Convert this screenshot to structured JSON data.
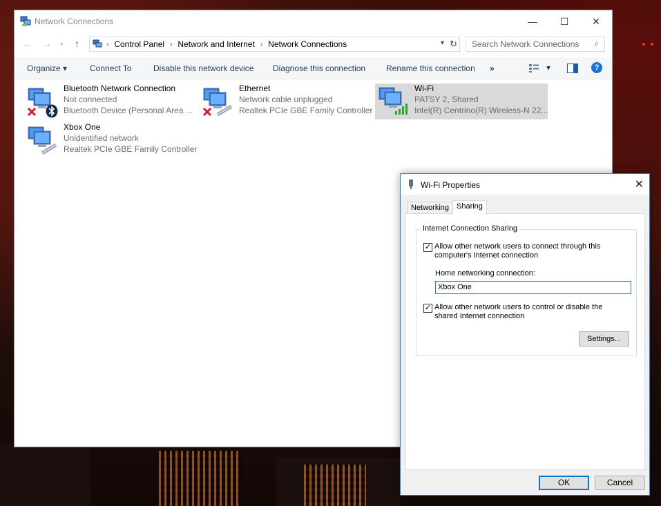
{
  "window": {
    "title": "Network Connections",
    "controls": {
      "minimize": "—",
      "maximize": "☐",
      "close": "✕"
    }
  },
  "address_bar": {
    "breadcrumbs": [
      "Control Panel",
      "Network and Internet",
      "Network Connections"
    ],
    "search_placeholder": "Search Network Connections"
  },
  "toolbar": {
    "organize": "Organize",
    "organize_caret": "▾",
    "connect_to": "Connect To",
    "disable": "Disable this network device",
    "diagnose": "Diagnose this connection",
    "rename": "Rename this connection",
    "more": "»",
    "view_caret": "▾",
    "help": "?"
  },
  "connections": [
    {
      "name": "Bluetooth Network Connection",
      "status": "Not connected",
      "device": "Bluetooth Device (Personal Area ...",
      "overlay": "bluetooth-icon",
      "error": true,
      "selected": false
    },
    {
      "name": "Ethernet",
      "status": "Network cable unplugged",
      "device": "Realtek PCIe GBE Family Controller",
      "overlay": "cable-icon",
      "error": true,
      "selected": false
    },
    {
      "name": "Wi-Fi",
      "status": "PATSY  2, Shared",
      "device": "Intel(R) Centrino(R) Wireless-N 22...",
      "overlay": "wifi-signal-icon",
      "error": false,
      "selected": true
    },
    {
      "name": "Xbox One",
      "status": "Unidentified network",
      "device": "Realtek PCIe GBE Family Controller",
      "overlay": "cable-icon",
      "error": false,
      "selected": false
    }
  ],
  "dialog": {
    "title": "Wi-Fi Properties",
    "close": "✕",
    "tabs": [
      "Networking",
      "Sharing"
    ],
    "active_tab": "Sharing",
    "group_title": "Internet Connection Sharing",
    "allow_connect_label": "Allow other network users to connect through this computer's Internet connection",
    "allow_connect_checked": true,
    "home_label": "Home networking connection:",
    "home_value": "Xbox One",
    "allow_control_label": "Allow other network users to control or disable the shared Internet connection",
    "allow_control_checked": true,
    "settings_button": "Settings...",
    "ok_button": "OK",
    "cancel_button": "Cancel",
    "check_mark": "✓"
  },
  "colors": {
    "accent": "#0078d7",
    "link_text": "#1e395b",
    "selected_bg": "#d9d9d9",
    "error_red": "#e81123",
    "signal_green": "#2aa33a"
  }
}
